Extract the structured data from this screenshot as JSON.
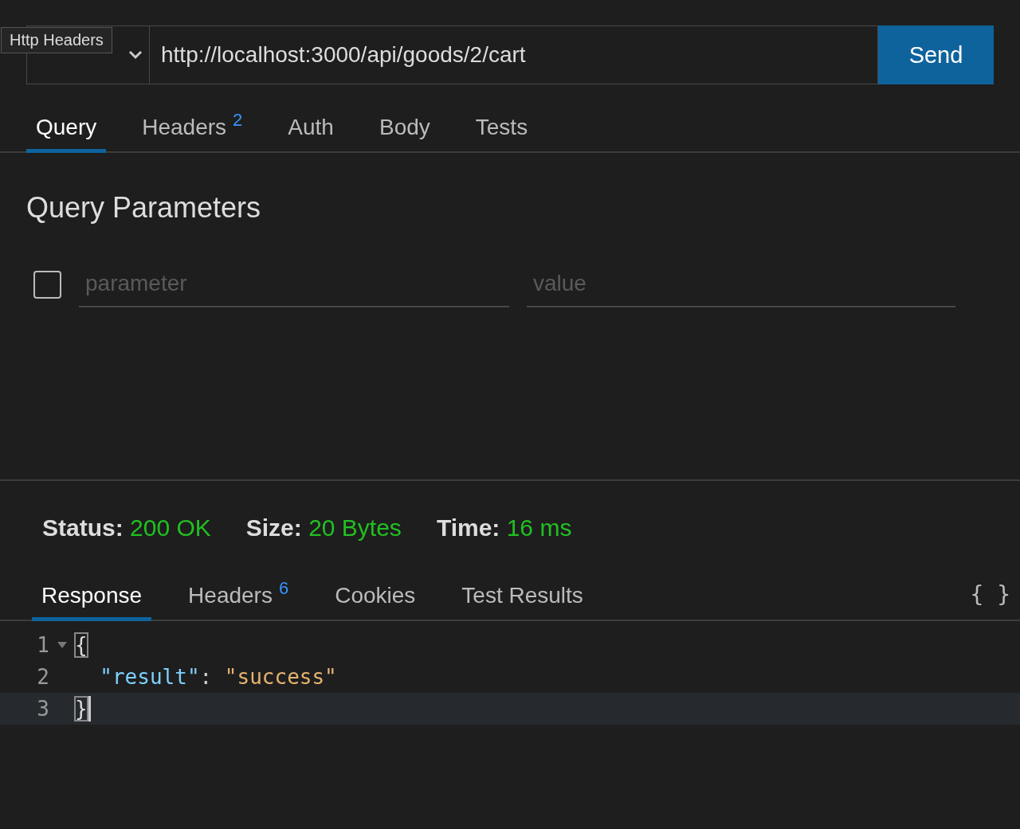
{
  "tooltip": {
    "text": "Http Headers"
  },
  "request": {
    "url": "http://localhost:3000/api/goods/2/cart",
    "send": "Send"
  },
  "request_tabs": [
    {
      "label": "Query",
      "selected": true
    },
    {
      "label": "Headers",
      "badge": "2",
      "selected": false
    },
    {
      "label": "Auth",
      "selected": false
    },
    {
      "label": "Body",
      "selected": false
    },
    {
      "label": "Tests",
      "selected": false
    }
  ],
  "query": {
    "title": "Query Parameters",
    "rows": [
      {
        "checked": false,
        "parameter_placeholder": "parameter",
        "value_placeholder": "value"
      }
    ]
  },
  "status": [
    {
      "label": "Status:",
      "value": "200 OK"
    },
    {
      "label": "Size:",
      "value": "20 Bytes"
    },
    {
      "label": "Time:",
      "value": "16 ms"
    }
  ],
  "response_tabs": [
    {
      "label": "Response",
      "selected": true
    },
    {
      "label": "Headers",
      "badge": "6",
      "selected": false
    },
    {
      "label": "Cookies",
      "selected": false
    },
    {
      "label": "Test Results",
      "selected": false
    }
  ],
  "format_button": "{ }",
  "code": [
    {
      "number": "1",
      "foldable": true,
      "current": false,
      "tokens": [
        {
          "kind": "bracket",
          "text": "{"
        }
      ]
    },
    {
      "number": "2",
      "foldable": false,
      "current": false,
      "tokens": [
        {
          "kind": "key",
          "text": "  \"result\""
        },
        {
          "kind": "punct",
          "text": ": "
        },
        {
          "kind": "string",
          "text": "\"success\""
        }
      ]
    },
    {
      "number": "3",
      "foldable": false,
      "current": true,
      "tokens": [
        {
          "kind": "bracket",
          "text": "}"
        }
      ]
    }
  ]
}
